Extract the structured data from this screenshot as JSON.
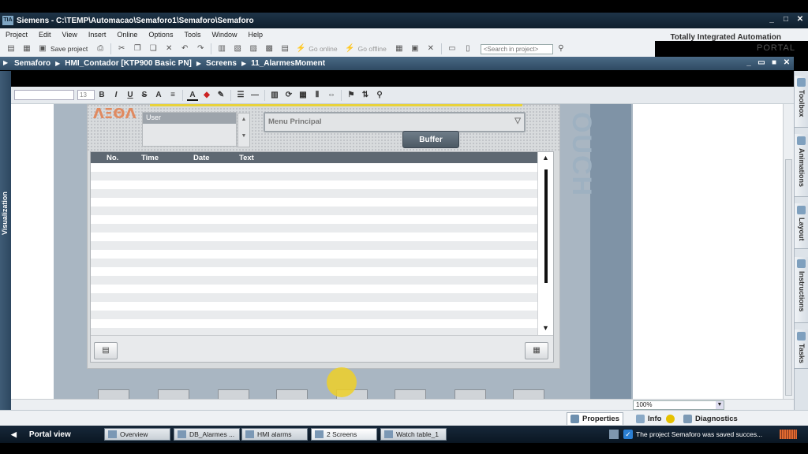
{
  "window": {
    "title": "Siemens  -  C:\\TEMP\\Automacao\\Semaforo1\\Semaforo\\Semaforo",
    "app_icon": "TIA",
    "controls": [
      "_",
      "□",
      "✕"
    ]
  },
  "menu": {
    "items": [
      "Project",
      "Edit",
      "View",
      "Insert",
      "Online",
      "Options",
      "Tools",
      "Window",
      "Help"
    ]
  },
  "brand": {
    "line1": "Totally Integrated Automation",
    "line2": "PORTAL"
  },
  "toolbar": {
    "save_label": "Save project",
    "go_online": "Go online",
    "go_offline": "Go offline",
    "search_placeholder": "<Search in project>"
  },
  "breadcrumb": {
    "items": [
      "Semaforo",
      "HMI_Contador [KTP900 Basic PN]",
      "Screens",
      "11_AlarmesMoment"
    ],
    "controls": [
      "_",
      "▭",
      "■",
      "✕"
    ]
  },
  "format_toolbar": {
    "font_size": "13"
  },
  "left_tab": {
    "label": "Visualization"
  },
  "screen": {
    "user_label": "User",
    "menu_select": "Menu Principal",
    "buffer_button": "Buffer",
    "touch_text": "OUCH",
    "logo_fragment": "ΛΞΘΛ",
    "alarm_columns": [
      "No.",
      "Time",
      "Date",
      "Text"
    ]
  },
  "zoom": {
    "value": "100%"
  },
  "task_tabs": [
    "Toolbox",
    "Animations",
    "Layout",
    "Instructions",
    "Tasks"
  ],
  "inspector": {
    "properties": "Properties",
    "info": "Info",
    "diagnostics": "Diagnostics"
  },
  "portal": {
    "portal_view": "Portal view",
    "tabs": [
      "Overview",
      "DB_Alarmes ...",
      "HMI alarms",
      "2 Screens",
      "Watch table_1"
    ],
    "status_message": "The project Semaforo was saved succes..."
  },
  "colors": {
    "title_bar": "#1e3448",
    "breadcrumb": "#3d5a74",
    "accent_yellow": "#e8d23a",
    "buffer_button": "#5c6975"
  }
}
